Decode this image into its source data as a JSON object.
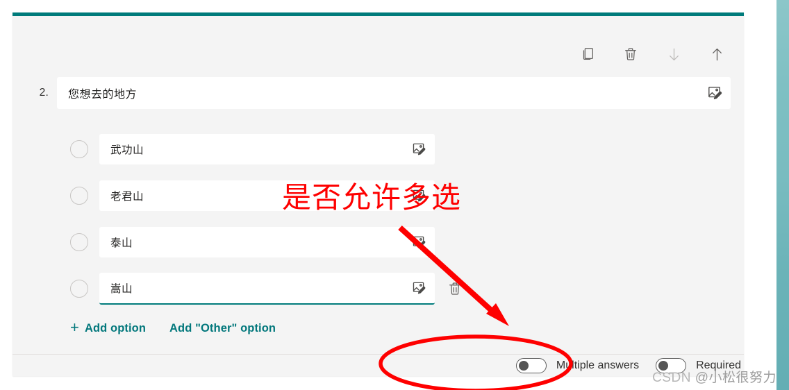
{
  "theme": {
    "accent": "#007b7b",
    "link": "#03787c",
    "card_bg": "#f4f4f4",
    "field_bg": "#ffffff",
    "annotation_red": "#fe0000",
    "edge_strip_top": "#8cc6c9",
    "edge_strip_bottom": "#63aeb4"
  },
  "toolbar": {
    "items": [
      {
        "name": "copy-icon",
        "label": "Copy question"
      },
      {
        "name": "delete-icon",
        "label": "Delete question"
      },
      {
        "name": "move-down-icon",
        "label": "Move question down"
      },
      {
        "name": "move-up-icon",
        "label": "Move question up"
      }
    ]
  },
  "question": {
    "number": "2.",
    "text": "您想去的地方",
    "image_button": "insert-image-icon"
  },
  "options": [
    {
      "text": "武功山",
      "focused": false,
      "has_delete": false
    },
    {
      "text": "老君山",
      "focused": false,
      "has_delete": false
    },
    {
      "text": "泰山",
      "focused": false,
      "has_delete": false
    },
    {
      "text": "嵩山",
      "focused": true,
      "has_delete": true
    }
  ],
  "actions": {
    "add_option": "Add option",
    "add_other_option": "Add \"Other\" option",
    "plus_glyph": "+"
  },
  "footer": {
    "toggles": [
      {
        "label": "Multiple answers",
        "on": false
      },
      {
        "label": "Required",
        "on": false
      }
    ]
  },
  "annotations": {
    "text": "是否允许多选",
    "arrow": "red-arrow",
    "ellipse": "red-ellipse"
  },
  "watermark": {
    "prefix": "CSDN ",
    "handle": "@小松很努力"
  }
}
